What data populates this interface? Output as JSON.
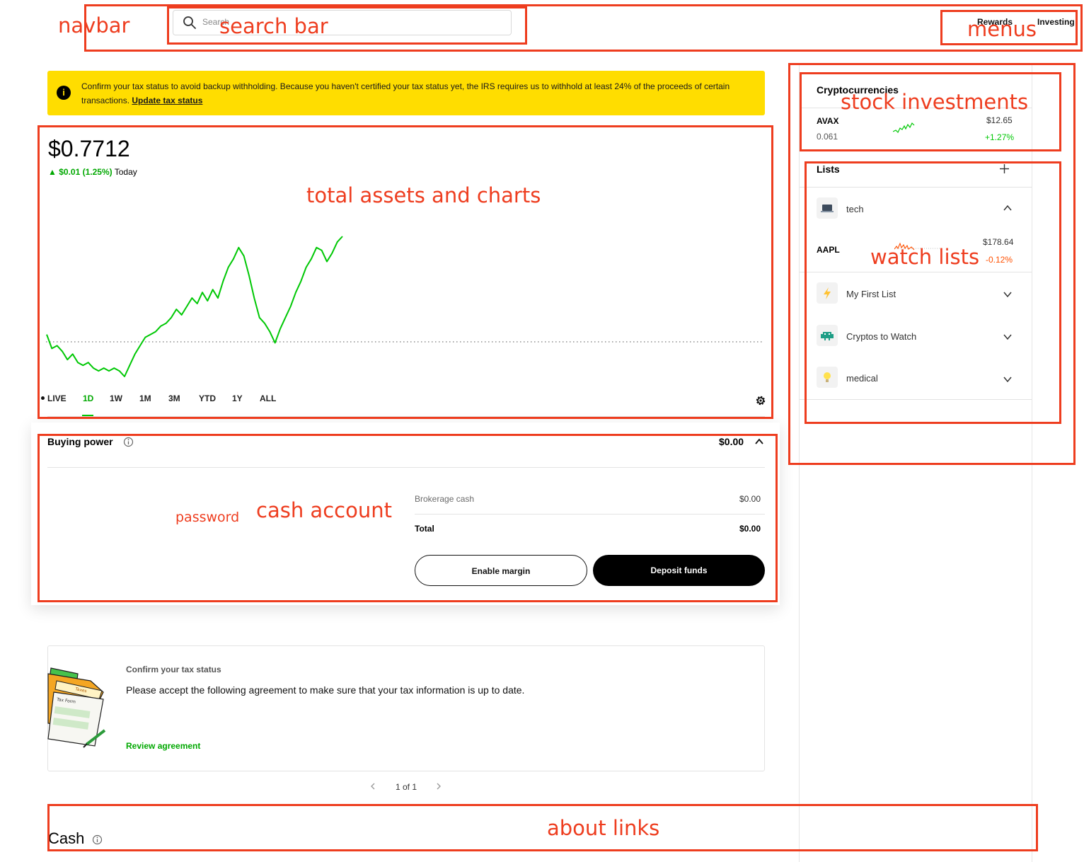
{
  "navbar": {
    "search_placeholder": "Search",
    "menu": [
      "Rewards",
      "Investing"
    ]
  },
  "banner": {
    "text": "Confirm your tax status to avoid backup withholding. Because you haven't certified your tax status yet, the IRS requires us to withhold at least 24% of the proceeds of certain transactions.",
    "link": "Update tax status",
    "icon": "info-icon"
  },
  "portfolio": {
    "value": "$0.7712",
    "change": "$0.01 (1.25%)",
    "period": "Today",
    "ranges": [
      "LIVE",
      "1D",
      "1W",
      "1M",
      "3M",
      "YTD",
      "1Y",
      "ALL"
    ],
    "active_range": "1D",
    "line_color": "#00c805",
    "chart_series": [
      0.762,
      0.757,
      0.758,
      0.756,
      0.753,
      0.755,
      0.752,
      0.751,
      0.752,
      0.75,
      0.749,
      0.75,
      0.749,
      0.75,
      0.749,
      0.747,
      0.751,
      0.755,
      0.758,
      0.761,
      0.762,
      0.763,
      0.765,
      0.766,
      0.768,
      0.771,
      0.769,
      0.772,
      0.775,
      0.773,
      0.777,
      0.774,
      0.778,
      0.775,
      0.781,
      0.786,
      0.789,
      0.793,
      0.79,
      0.783,
      0.775,
      0.768,
      0.766,
      0.763,
      0.759,
      0.764,
      0.768,
      0.772,
      0.777,
      0.781,
      0.786,
      0.789,
      0.793,
      0.792,
      0.788,
      0.791,
      0.795,
      0.797
    ]
  },
  "buying_power": {
    "title": "Buying power",
    "amount": "$0.00",
    "rows": [
      {
        "label": "Brokerage cash",
        "value": "$0.00"
      },
      {
        "label": "Total",
        "value": "$0.00"
      }
    ],
    "enable_margin": "Enable margin",
    "deposit": "Deposit funds"
  },
  "tax_card": {
    "title": "Confirm your tax status",
    "body": "Please accept the following agreement to make sure that your tax information is up to date.",
    "link": "Review agreement",
    "pager": "1 of 1",
    "folder_label": "Taxes",
    "form_label": "Tax Form"
  },
  "cash": {
    "title": "Cash"
  },
  "sidebar": {
    "crypto_title": "Cryptocurrencies",
    "crypto": [
      {
        "symbol": "AVAX",
        "qty": "0.061",
        "price": "$12.65",
        "change": "+1.27%"
      }
    ],
    "lists_title": "Lists",
    "lists": [
      {
        "name": "tech",
        "icon": "laptop-icon",
        "expanded": true
      },
      {
        "name": "My First List",
        "icon": "lightning-icon",
        "expanded": false
      },
      {
        "name": "Cryptos to Watch",
        "icon": "alien-icon",
        "expanded": false
      },
      {
        "name": "medical",
        "icon": "lightbulb-icon",
        "expanded": false
      }
    ],
    "tech_items": [
      {
        "symbol": "AAPL",
        "price": "$178.64",
        "change": "-0.12%"
      }
    ]
  },
  "annotations": [
    "navbar",
    "search bar",
    "menus",
    "stock investments",
    "total assets and charts",
    "watch lists",
    "password",
    "cash account",
    "about links"
  ],
  "colors": {
    "annotation": "#ee3d1f",
    "green": "#00c805",
    "negative": "#ff5000",
    "banner": "#ffdd00"
  }
}
